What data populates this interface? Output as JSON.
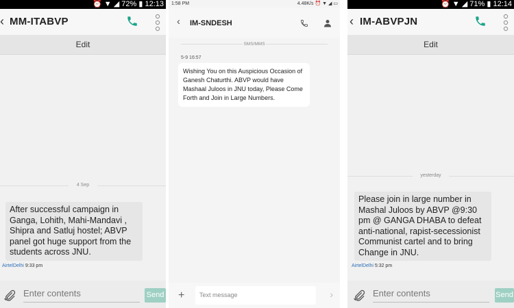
{
  "panels": [
    {
      "status": {
        "left": "",
        "battery": "72%",
        "time": "12:13"
      },
      "title": "MM-ITABVP",
      "edit_label": "Edit",
      "date": "4 Sep",
      "message": "After successful campaign in Ganga, Lohith, Mahi-Mandavi , Shipra and Satluj hostel; ABVP panel got huge support from the students across JNU.",
      "operator": "AirtelDelhi",
      "time": "9:33 pm",
      "input_placeholder": "Enter contents",
      "send_label": "Send"
    },
    {
      "status": {
        "left": "1:58 PM",
        "speed": "4.48K/s"
      },
      "title": "IM-SNDESH",
      "tab_label": "SMS/MMS",
      "timestamp": "5-9 16:57",
      "message": "Wishing You on this Auspicious Occasion of Ganesh Chaturthi. ABVP would have Mashaal Juloos in JNU today, Please Come Forth and Join in Large Numbers.",
      "input_placeholder": "Text message"
    },
    {
      "status": {
        "left": "",
        "battery": "71%",
        "time": "12:14"
      },
      "title": "IM-ABVPJN",
      "edit_label": "Edit",
      "date": "yesterday",
      "message": "Please join in large number in Mashal Juloos by ABVP @9:30 pm @ GANGA DHABA to defeat anti-national, rapist-secessionist Communist cartel and to bring Change in JNU.",
      "operator": "AirtelDelhi",
      "time": "5:32 pm",
      "input_placeholder": "Enter contents",
      "send_label": "Send"
    }
  ],
  "colors": {
    "accent": "#1aa58a",
    "send_bg": "#9ed0c3",
    "operator": "#2f6fb5"
  }
}
